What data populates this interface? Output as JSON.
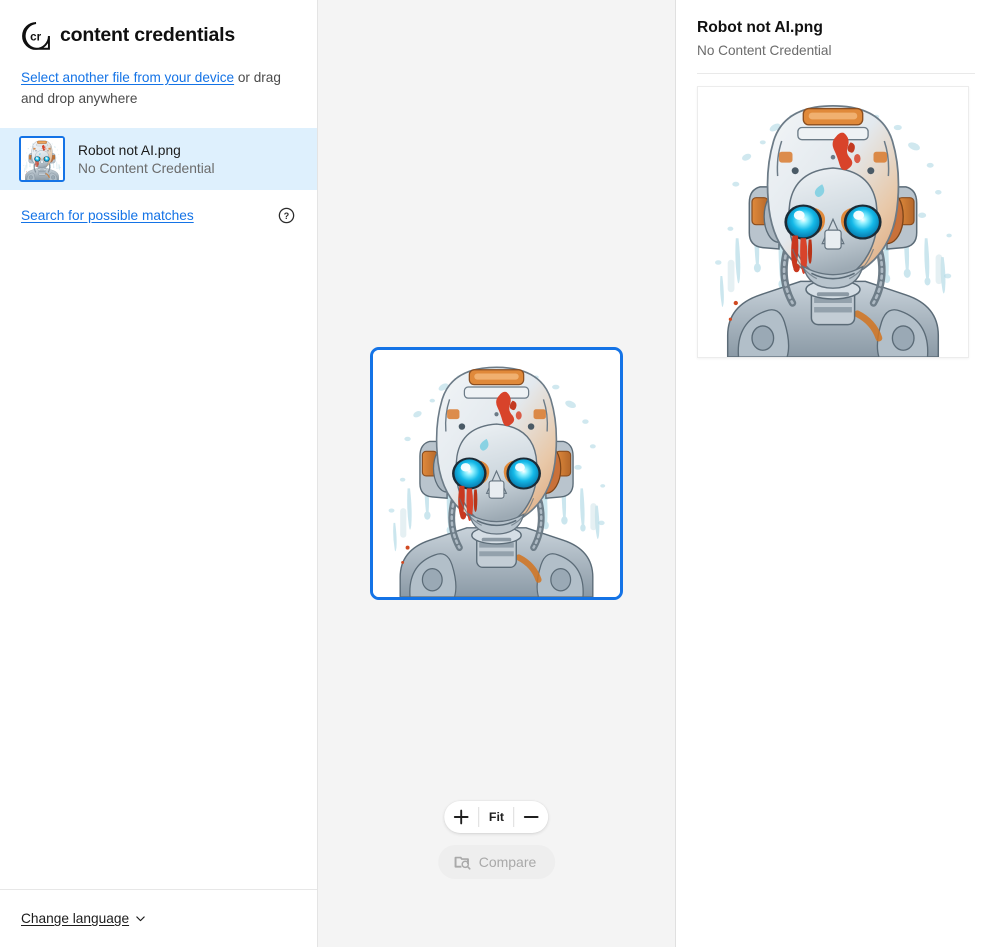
{
  "brand": {
    "logo_icon": "content-credentials-cr-icon",
    "title": "content credentials"
  },
  "sidebar": {
    "upload": {
      "link_label": "Select another file from your device",
      "suffix_text": " or drag and drop anywhere"
    },
    "file": {
      "name": "Robot not AI.png",
      "status": "No Content Credential",
      "thumbnail_alt": "robot-thumbnail",
      "selected": true
    },
    "search": {
      "link_label": "Search for possible matches",
      "help_icon": "question-circle-icon"
    },
    "footer": {
      "language_label": "Change language",
      "chevron_icon": "chevron-down-icon"
    }
  },
  "viewer": {
    "image_alt": "robot-preview",
    "controls": {
      "zoom_in_icon": "plus-icon",
      "zoom_in_label": "+",
      "fit_label": "Fit",
      "zoom_out_icon": "minus-icon",
      "zoom_out_label": "−",
      "compare_label": "Compare",
      "compare_icon": "image-search-icon",
      "compare_disabled": true
    }
  },
  "right_panel": {
    "title": "Robot not AI.png",
    "subtitle": "No Content Credential",
    "image_alt": "robot-detail-preview"
  },
  "colors": {
    "accent_blue": "#1473e6",
    "selected_row_bg": "#def0fd",
    "viewer_bg": "#f4f4f4",
    "text_primary": "#1c1c1c",
    "text_secondary": "#6b6b6b",
    "disabled_text": "#a9a9a9"
  }
}
